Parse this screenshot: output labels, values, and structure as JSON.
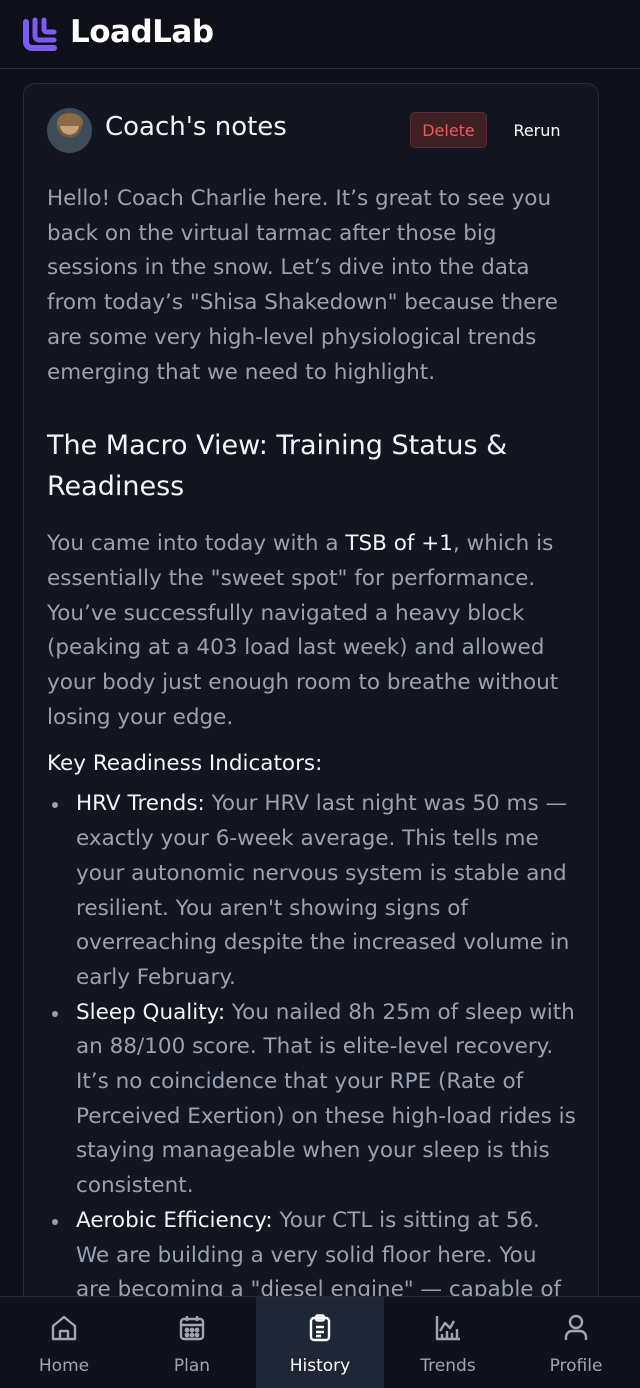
{
  "app": {
    "name": "LoadLab"
  },
  "card": {
    "title": "Coach's notes",
    "delete_label": "Delete",
    "rerun_label": "Rerun"
  },
  "notes": {
    "intro": "Hello! Coach Charlie here. It’s great to see you back on the virtual tarmac after those big sessions in the snow. Let’s dive into the data from today’s \"Shisa Shakedown\" because there are some very high-level physiological trends emerging that we need to highlight.",
    "heading1": "The Macro View: Training Status & Readiness",
    "p2_before": "You came into today with a ",
    "p2_bold": "TSB of +1",
    "p2_after": ", which is essentially the \"sweet spot\" for performance. You’ve successfully navigated a heavy block (peaking at a 403 load last week) and allowed your body just enough room to breathe without losing your edge.",
    "subheading": "Key Readiness Indicators:",
    "indicators": [
      {
        "title": "HRV Trends:",
        "text": " Your HRV last night was 50 ms — exactly your 6-week average. This tells me your autonomic nervous system is stable and resilient. You aren't showing signs of overreaching despite the increased volume in early February."
      },
      {
        "title": "Sleep Quality:",
        "text": " You nailed 8h 25m of sleep with an 88/100 score. That is elite-level recovery. It’s no coincidence that your RPE (Rate of Perceived Exertion) on these high-load rides is staying manageable when your sleep is this consistent."
      },
      {
        "title": "Aerobic Efficiency:",
        "text": " Your CTL is sitting at 56. We are building a very solid floor here. You are becoming a \"diesel engine\" — capable of"
      }
    ]
  },
  "nav": [
    {
      "label": "Home",
      "icon": "home-icon"
    },
    {
      "label": "Plan",
      "icon": "calendar-icon"
    },
    {
      "label": "History",
      "icon": "clipboard-icon",
      "active": true
    },
    {
      "label": "Trends",
      "icon": "chart-icon"
    },
    {
      "label": "Profile",
      "icon": "user-icon"
    }
  ],
  "colors": {
    "accent": "#7c5cf0",
    "delete": "#ea5a5a",
    "background": "#0e1019"
  }
}
